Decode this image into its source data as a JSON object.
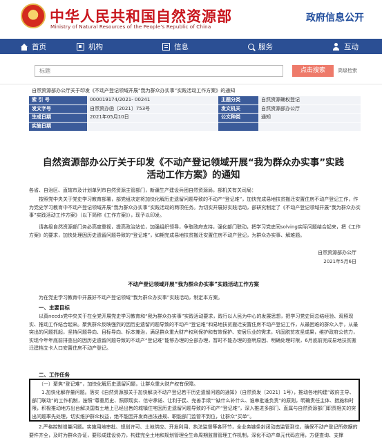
{
  "header": {
    "site_title": "中华人民共和国自然资源部",
    "site_subtitle": "Ministry of Natural Resources of the People’s Republic of China",
    "gov_info": "政府信息公开",
    "brand_color": "#c8161d",
    "nav_color": "#2b4f94"
  },
  "nav": [
    {
      "label": "首页",
      "icon": "home-icon"
    },
    {
      "label": "机构",
      "icon": "org-icon"
    },
    {
      "label": "信息",
      "icon": "doc-icon"
    },
    {
      "label": "服务",
      "icon": "search-icon"
    },
    {
      "label": "互动",
      "icon": "person-icon"
    }
  ],
  "search": {
    "placeholder": "标题",
    "button_label": "点击搜索",
    "advanced_label": "高级检索"
  },
  "info": {
    "breadcrumb": "自然资源部办公厅关于印发《不动产登记领域开展“我为群众办实事”实践活动工作方案》的通知",
    "rows": [
      {
        "k1": "索 引 号",
        "v1": "000019174/2021- 00241",
        "k2": "主题分类",
        "v2": "自然资源确权登记"
      },
      {
        "k1": "发文字号",
        "v1": "自然资办函〔2021〕753号",
        "k2": "发文机关",
        "v2": "自然资源部办公厅"
      },
      {
        "k1": "生成日期",
        "v1": "2021年05月10日",
        "k2": "公文种类",
        "v2": "通知"
      },
      {
        "k1": "实施日期",
        "v1": "",
        "k2": "",
        "v2": ""
      }
    ]
  },
  "article": {
    "title": "自然资源部办公厅关于印发《不动产登记领域开展“我为群众办实事”实践活动工作方案》的通知",
    "salutation": "各省、自治区、直辖市及计划单列市自然资源主管部门，新疆生产建设兵团自然资源局，部机关有关司局：",
    "para1": "按照党中央关于党史学习教育部署，部党组决定将加快化解历史遗留问题导致的不动产“登记难”，加快完成易地扶贫搬迁安置住房不动产登记工作，作为党史学习教育中不动产登记领域开展“我为群众办实事”实践活动的两项任务。为切实开展好实践活动，部研究制定了《不动产登记领域开展“我为群众办实事”实践活动工作方案》（以下简称《工作方案》），现予以印发。",
    "para2": "请各级自然资源部门务必高度重视，提高政治站位，加强组织领导，争取政府支持，强化部门联动，把学习党史同solving实际问题结合起来，把《工作方案》的要求，加快处理因历史遗留问题导致的“登记难”，如期完成易地扶贫搬迁安置住房不动产登记，为群众办实事、解难题。",
    "signer": "自然资源部办公厅",
    "sign_date": "2021年5月6日",
    "sub_title": "不动产登记领域开展“我为群众办实事”实践活动工作方案",
    "intro": "为在党史学习教育中开展好不动产登记领域“我为群众办实事”实践活动，制定本方案。",
    "sec1": "一、主要目标",
    "sec1_body": "以真needs党中央关于在全党开展党史学习教育和“我为群众办实事”实践活动要求，践行以人民为中心的发展思想，把学习党史同总结经验、观照现实、推动工作结合起来。聚焦群众反映强烈的因历史遗留问题导致的不动产“登记难”和易地扶贫搬迁安置住房不动产登记工作，从最困难的群众入手，从最突出的问题抓起，坚持问题导向、目标导向、标本兼治，满足群众重大财产权利保护和有效保护、安居乐业的需求，巩固脱贫攻坚成果，维护政府公信力，实现今年年底前排查出的因历史遗留问题导致的不动产“登记难”能够办理的全部办理，暂时不能办理的查明原因、明确处理时限，6月底前完成易地扶贫搬迁建档立卡人口安置住房不动产登记。",
    "sec2": "二、工作任务",
    "sec2_sub1": "（一）聚焦“登记难”，加快化解历史遗留问题，让群众重大财产权有保障。",
    "sec2_item1": "1.加快化解存量问题。落实《自然资源部关于加快解决不动产登记若干历史遗留问题的通知》（自然资发〔2021〕1号），推动各地构建“政府主导、部门联动”的工作机制，按照“尊重历史、照顾现实、信守承诺、让利于民、完善手续”“缺什么补什么、谁审批谁负责”的原则，明确责任主体、措施和时限，积极推动地方出台解决国有土地上已经出售的城镇住宅因历史遗留问题导致的不动产“登记难”，深入推进多部门、直属与自然资源部门职责相关的突出问题率先处理，切实维护群众权益，绝不能因开发商违法违规、职能部门监管不到位，让群众“买单”。",
    "sec2_item2": "2.严格控制增量问题。实施用地审批、规划许可、土地供应、开发利用、执法监督等各环节，全业务链条封闭动态监管到位，确保不动产登记所依据的要件齐全，及时为群众办证，要形成建设协力，构建完全土地和规划管理全生命周期监督管理工作机制，深化不动产单元代码应用，方便查询、支撑"
  }
}
